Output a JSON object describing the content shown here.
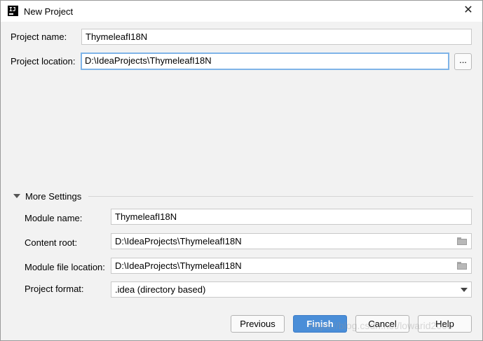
{
  "window": {
    "title": "New Project",
    "close_glyph": "✕"
  },
  "main": {
    "project_name_label": "Project name:",
    "project_name_value": "ThymeleafI18N",
    "project_location_label": "Project location:",
    "project_location_value": "D:\\IdeaProjects\\ThymeleafI18N",
    "browse_label": "..."
  },
  "more_settings": {
    "label": "More Settings",
    "module_name_label": "Module name:",
    "module_name_value": "ThymeleafI18N",
    "content_root_label": "Content root:",
    "content_root_value": "D:\\IdeaProjects\\ThymeleafI18N",
    "module_file_location_label": "Module file location:",
    "module_file_location_value": "D:\\IdeaProjects\\ThymeleafI18N",
    "project_format_label": "Project format:",
    "project_format_value": ".idea (directory based)"
  },
  "buttons": {
    "previous": "Previous",
    "finish": "Finish",
    "cancel": "Cancel",
    "help": "Help"
  },
  "watermark": "https://blog.csdn.net/lowarid2005",
  "icons": [
    "intellij-app-icon",
    "close-icon",
    "collapse-triangle-icon",
    "folder-icon",
    "dropdown-arrow-icon"
  ],
  "colors": {
    "accent": "#4a8ed8",
    "focus": "#7fb4e8",
    "dialog_bg": "#f2f2f2"
  }
}
